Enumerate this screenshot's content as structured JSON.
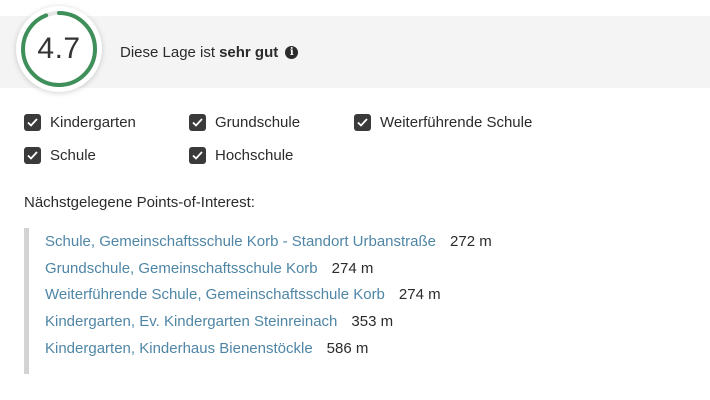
{
  "rating": {
    "score": "4.7",
    "score_fraction": 0.94,
    "ring_color": "#3f8f5a",
    "text_prefix": "Diese Lage ist",
    "text_strong": "sehr gut",
    "info_icon": "info-icon"
  },
  "filters": [
    {
      "label": "Kindergarten",
      "checked": true
    },
    {
      "label": "Grundschule",
      "checked": true
    },
    {
      "label": "Weiterführende Schule",
      "checked": true
    },
    {
      "label": "Schule",
      "checked": true
    },
    {
      "label": "Hochschule",
      "checked": true
    }
  ],
  "poi": {
    "heading": "Nächstgelegene Points-of-Interest:",
    "items": [
      {
        "name": "Schule, Gemeinschaftsschule Korb - Standort Urbanstraße",
        "distance": "272 m"
      },
      {
        "name": "Grundschule, Gemeinschaftsschule Korb",
        "distance": "274 m"
      },
      {
        "name": "Weiterführende Schule, Gemeinschaftsschule Korb",
        "distance": "274 m"
      },
      {
        "name": "Kindergarten, Ev. Kindergarten Steinreinach",
        "distance": "353 m"
      },
      {
        "name": "Kindergarten, Kinderhaus Bienenstöckle",
        "distance": "586 m"
      }
    ]
  },
  "colors": {
    "link": "#4f86a6",
    "checkbox": "#3a3a3a"
  }
}
